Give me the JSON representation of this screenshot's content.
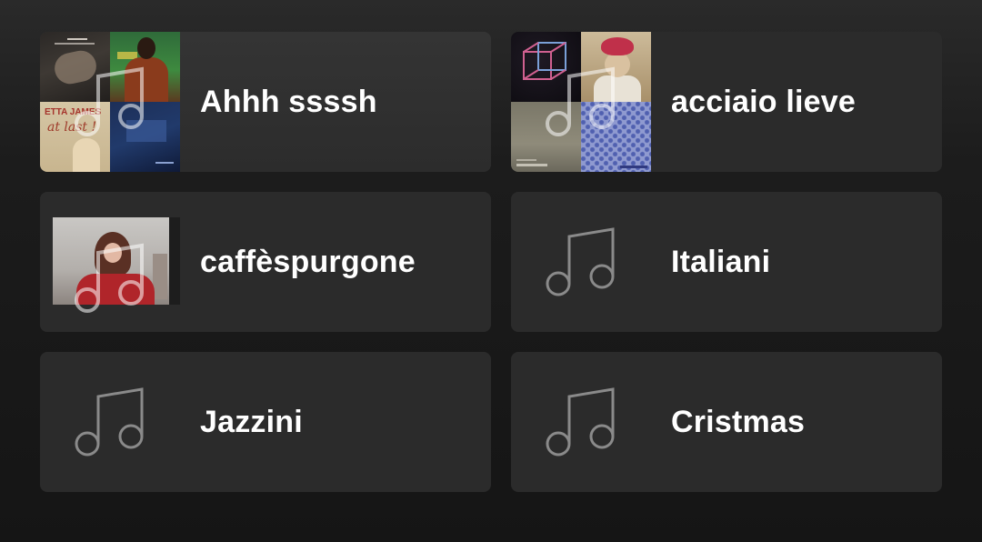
{
  "playlists": [
    {
      "title": "Ahhh ssssh",
      "thumb": "mosaic"
    },
    {
      "title": "acciaio lieve",
      "thumb": "mosaic"
    },
    {
      "title": "caffèspurgone",
      "thumb": "photo"
    },
    {
      "title": "Italiani",
      "thumb": "music-note-icon"
    },
    {
      "title": "Jazzini",
      "thumb": "music-note-icon"
    },
    {
      "title": "Cristmas",
      "thumb": "music-note-icon"
    }
  ],
  "album_text": {
    "etta_artist": "ETTA JAMES",
    "etta_album": "at last !"
  },
  "colors": {
    "card_bg": "#2b2b2b",
    "title": "#ffffff",
    "icon_stroke": "#8a8a8a",
    "page_bg": "#151515"
  }
}
